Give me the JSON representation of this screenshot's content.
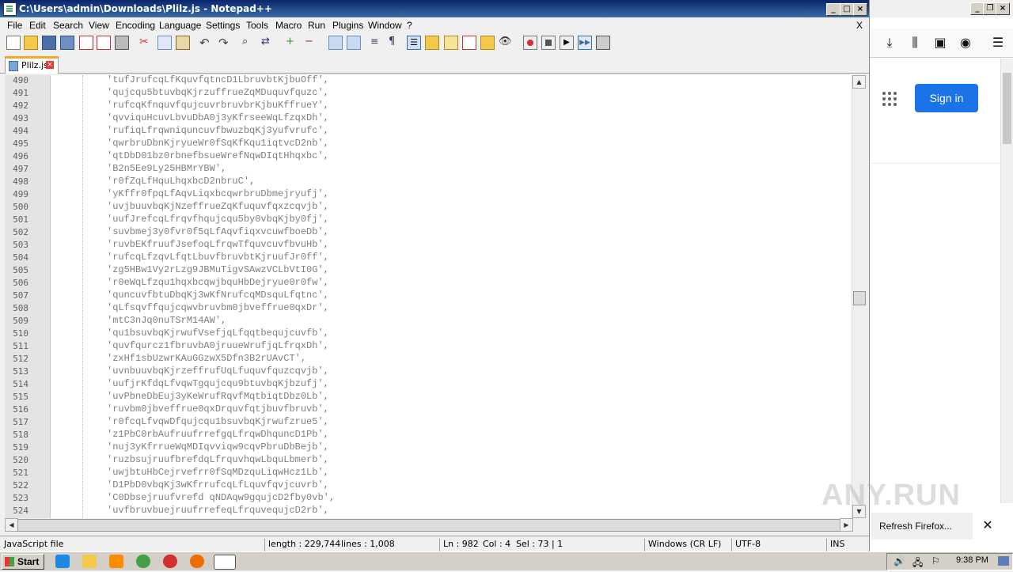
{
  "window": {
    "title": "C:\\Users\\admin\\Downloads\\Plilz.js - Notepad++",
    "close_label": "X"
  },
  "menu": [
    "File",
    "Edit",
    "Search",
    "View",
    "Encoding",
    "Language",
    "Settings",
    "Tools",
    "Macro",
    "Run",
    "Plugins",
    "Window",
    "?"
  ],
  "tab": {
    "label": "Plilz.js"
  },
  "editor": {
    "lines": [
      {
        "n": "490",
        "t": "'tufJrufcqLfKquvfqtncD1LbruvbtKjbuOff',"
      },
      {
        "n": "491",
        "t": "'qujcqu5btuvbqKjrzuffrueZqMDuquvfquzc',"
      },
      {
        "n": "492",
        "t": "'rufcqKfnquvfqujcuvrbruvbrKjbuKffrueY',"
      },
      {
        "n": "493",
        "t": "'qvviquHcuvLbvuDbA0j3yKfrseeWqLfzqxDh',"
      },
      {
        "n": "494",
        "t": "'rufiqLfrqwniquncuvfbwuzbqKj3yufvrufc',"
      },
      {
        "n": "495",
        "t": "'qwrbruDbnKjryueWr0fSqKfKqu1iqtvcD2nb',"
      },
      {
        "n": "496",
        "t": "'qtDbD01bz0rbnefbsueWrefNqwDIqtHhqxbc',"
      },
      {
        "n": "497",
        "t": "'B2n5Ee9Ly25HBMrYBW',"
      },
      {
        "n": "498",
        "t": "'r0fZqLfHquLhqxbcD2nbruC',"
      },
      {
        "n": "499",
        "t": "'yKffr0fpqLfAqvLiqxbcqwrbruDbmejryufj',"
      },
      {
        "n": "500",
        "t": "'uvjbuuvbqKjNzeffrueZqKfuquvfqxzcqvjb',"
      },
      {
        "n": "501",
        "t": "'uufJrefcqLfrqvfhqujcqu5by0vbqKjby0fj',"
      },
      {
        "n": "502",
        "t": "'suvbmej3y0fvr0f5qLfAqvfiqxvcuwfboeDb',"
      },
      {
        "n": "503",
        "t": "'ruvbEKfruufJsefoqLfrqwTfquvcuvfbvuHb',"
      },
      {
        "n": "504",
        "t": "'rufcqLfzqvLfqtLbuvfbruvbtKjruufJr0ff',"
      },
      {
        "n": "505",
        "t": "'zg5HBw1Vy2rLzg9JBMuTigvSAwzVCLbVtI0G',"
      },
      {
        "n": "506",
        "t": "'r0eWqLfzqu1hqxbcqwjbquHbDejryue0r0fw',"
      },
      {
        "n": "507",
        "t": "'quncuvfbtuDbqKj3wKfNrufcqMDsquLfqtnc',"
      },
      {
        "n": "508",
        "t": "'qLfsqvffqujcqwvbruvbm0jbveffrue0qxDr',"
      },
      {
        "n": "509",
        "t": "'mtC3nJq0nuTSrM14AW',"
      },
      {
        "n": "510",
        "t": "'qu1bsuvbqKjrwufVsefjqLfqqtbequjcuvfb',"
      },
      {
        "n": "511",
        "t": "'quvfqurcz1fbruvbA0jruueWrufjqLfrqxDh',"
      },
      {
        "n": "512",
        "t": "'zxHf1sbUzwrKAuGGzwX5Dfn3B2rUAvCT',"
      },
      {
        "n": "513",
        "t": "'uvnbuuvbqKjrzeffrufUqLfuquvfquzcqvjb',"
      },
      {
        "n": "514",
        "t": "'uufjrKfdqLfvqwTgqujcqu9btuvbqKjbzufj',"
      },
      {
        "n": "515",
        "t": "'uvPbneDbEuj3yKeWrufRqvfMqtbiqtDbz0Lb',"
      },
      {
        "n": "516",
        "t": "'ruvbm0jbveffrue0qxDrquvfqtjbuvfbruvb',"
      },
      {
        "n": "517",
        "t": "'r0fcqLfvqwDfqujcqu1bsuvbqKjrwufzrue5',"
      },
      {
        "n": "518",
        "t": "'z1PbC0rbAufruufrrefgqLfrqwDhquncD1Pb',"
      },
      {
        "n": "519",
        "t": "'nuj3yKfrrueWqMDIqvviqw9cqvPbruDbBejb',"
      },
      {
        "n": "520",
        "t": "'ruzbsujruufbrefdqLfrquvhqwLbquLbmerb',"
      },
      {
        "n": "521",
        "t": "'uwjbtuHbCejrvefrr0fSqMDzquLiqwHcz1Lb',"
      },
      {
        "n": "522",
        "t": "'D1PbD0vbqKj3wKfrrufcqLfLquvfqvjcuvrb',"
      },
      {
        "n": "523",
        "t": "'C0Dbsejruufvrefd qNDAqw9gqujcD2fby0vb',"
      },
      {
        "n": "524",
        "t": "'uvfbruvbuejruufrrefeqLfrquvequjcD2rb',"
      }
    ]
  },
  "status": {
    "filetype": "JavaScript file",
    "length": "length : 229,744",
    "lines": "lines : 1,008",
    "ln": "Ln : 982",
    "col": "Col : 4",
    "sel": "Sel : 73 | 1",
    "eol": "Windows (CR LF)",
    "encoding": "UTF-8",
    "mode": "INS"
  },
  "firefox": {
    "signin_label": "Sign in",
    "notification": "Refresh Firefox...",
    "watermark": "ANY.RUN"
  },
  "taskbar": {
    "start_label": "Start",
    "clock": "9:38 PM"
  },
  "colors": {
    "title_bar": "#0a246a",
    "signin_button": "#1a73e8",
    "tab_accent": "#f9a825"
  }
}
